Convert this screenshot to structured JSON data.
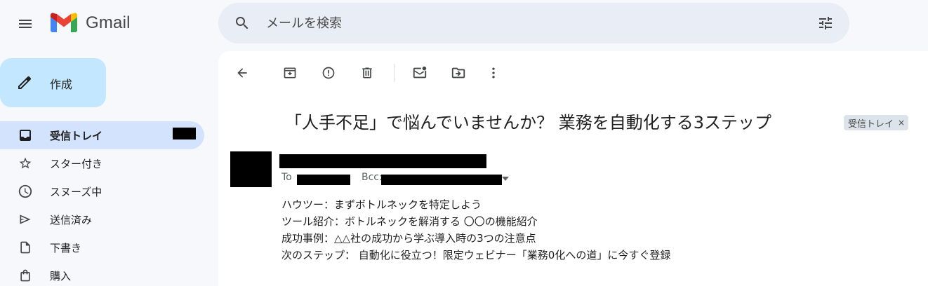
{
  "app": {
    "name": "Gmail"
  },
  "search": {
    "placeholder": "メールを検索"
  },
  "compose": {
    "label": "作成"
  },
  "sidebar": {
    "items": [
      {
        "label": "受信トレイ",
        "icon": "inbox-icon",
        "active": true
      },
      {
        "label": "スター付き",
        "icon": "star-icon"
      },
      {
        "label": "スヌーズ中",
        "icon": "clock-icon"
      },
      {
        "label": "送信済み",
        "icon": "send-icon"
      },
      {
        "label": "下書き",
        "icon": "draft-icon"
      },
      {
        "label": "購入",
        "icon": "shopping-bag-icon"
      }
    ]
  },
  "toolbar": {
    "icons": [
      "back-arrow-icon",
      "archive-icon",
      "report-spam-icon",
      "delete-icon",
      "mark-unread-icon",
      "move-to-icon",
      "more-vert-icon"
    ]
  },
  "email": {
    "subject": "「人手不足」で悩んでいませんか？ 業務を自動化する3ステップ",
    "label_chip": "受信トレイ",
    "chip_close": "×",
    "to_prefix": "To",
    "bcc_prefix": "Bcc:",
    "body_lines": [
      "ハウツー：まずボトルネックを特定しよう",
      "ツール紹介：ボトルネックを解消する 〇〇の機能紹介",
      "成功事例：△△社の成功から学ぶ導入時の3つの注意点",
      "次のステップ： 自動化に役立つ！限定ウェビナー「業務0化への道」に今すぐ登録"
    ]
  },
  "colors": {
    "background": "#f6f8fc",
    "search_bg": "#e9eef6",
    "compose_bg": "#c2e7ff",
    "active_nav_bg": "#d3e3fd",
    "gmail_red": "#ea4335",
    "gmail_blue": "#4285f4",
    "gmail_green": "#34a853",
    "gmail_yellow": "#fbbc04"
  }
}
